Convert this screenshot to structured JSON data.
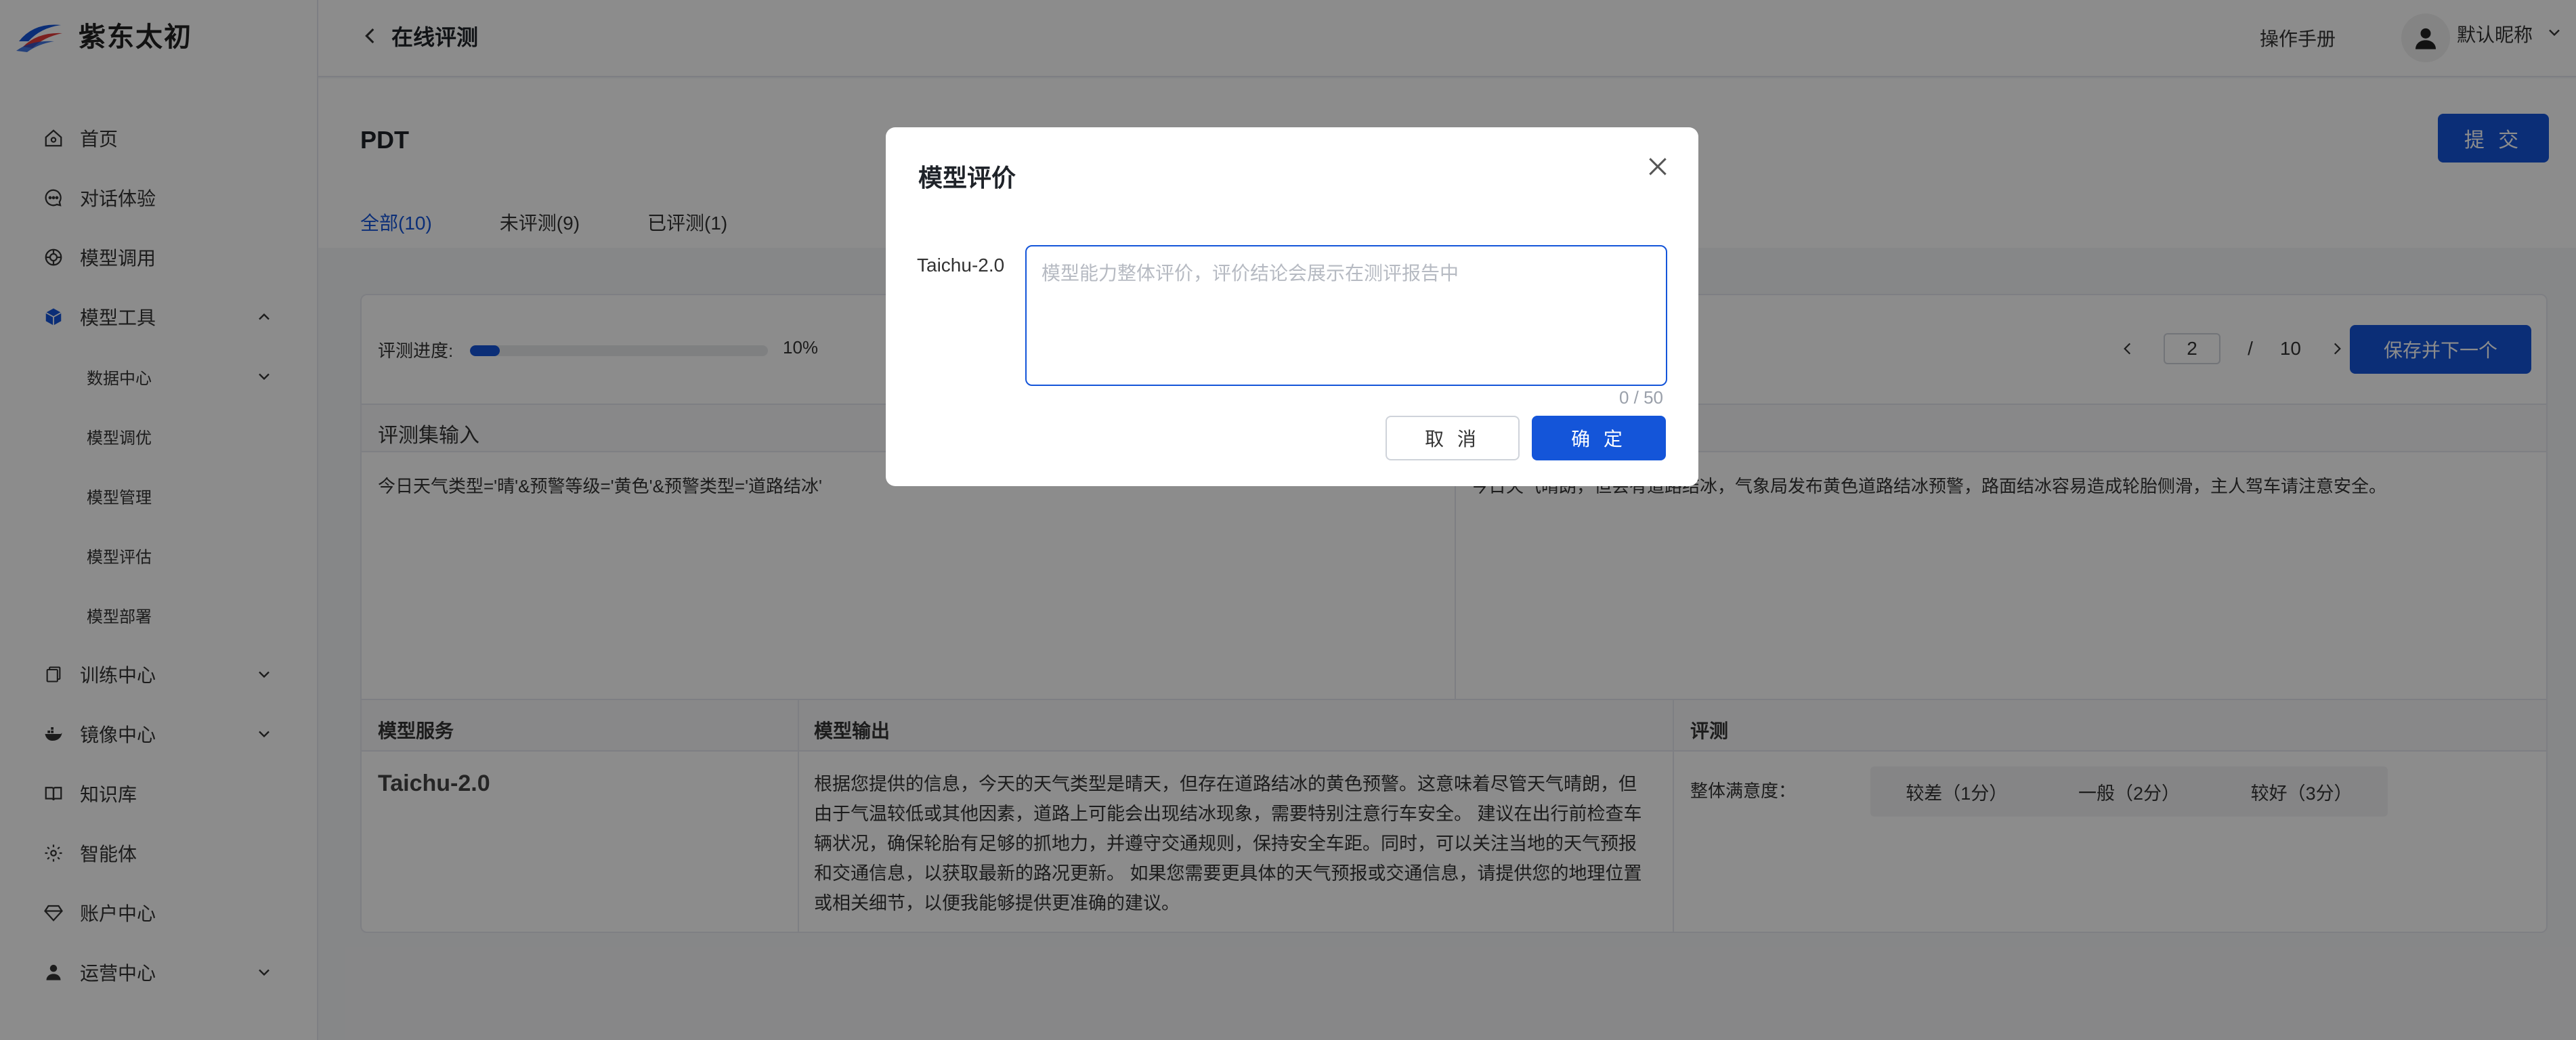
{
  "colors": {
    "accent": "#1455d9",
    "text": "#1f2329",
    "overlay": "rgba(0,0,0,0.45)"
  },
  "brand": {
    "name": "紫东太初"
  },
  "sidebar": {
    "items": [
      {
        "label": "首页",
        "icon": "home-icon"
      },
      {
        "label": "对话体验",
        "icon": "chat-icon"
      },
      {
        "label": "模型调用",
        "icon": "api-icon"
      },
      {
        "label": "模型工具",
        "icon": "cube-icon",
        "expanded": true
      },
      {
        "label": "数据中心",
        "sub": true,
        "chevron": "down"
      },
      {
        "label": "模型调优",
        "sub": true
      },
      {
        "label": "模型管理",
        "sub": true
      },
      {
        "label": "模型评估",
        "sub": true
      },
      {
        "label": "模型部署",
        "sub": true
      },
      {
        "label": "训练中心",
        "icon": "copy-icon",
        "chevron": "down"
      },
      {
        "label": "镜像中心",
        "icon": "docker-icon",
        "chevron": "down"
      },
      {
        "label": "知识库",
        "icon": "book-icon"
      },
      {
        "label": "智能体",
        "icon": "gear-icon"
      },
      {
        "label": "账户中心",
        "icon": "diamond-icon"
      },
      {
        "label": "运营中心",
        "icon": "user-icon",
        "chevron": "down"
      }
    ]
  },
  "header": {
    "back_label": "在线评测",
    "manual": "操作手册",
    "username": "默认昵称"
  },
  "page": {
    "title": "PDT",
    "submit": "提 交",
    "tabs": [
      {
        "label": "全部(10)",
        "active": true
      },
      {
        "label": "未评测(9)"
      },
      {
        "label": "已评测(1)"
      }
    ]
  },
  "progress": {
    "label": "评测进度:",
    "value": 0.1,
    "pct_text": "10%"
  },
  "pager": {
    "current": "2",
    "separator": "/",
    "total": "10",
    "save_next": "保存并下一个"
  },
  "eval_input": {
    "heading": "评测集输入",
    "left": "今日天气类型='晴'&预警等级='黄色'&预警类型='道路结冰'",
    "right": "今日天气晴朗，但会有道路结冰，气象局发布黄色道路结冰预警，路面结冰容易造成轮胎侧滑，主人驾车请注意安全。"
  },
  "table": {
    "headers": [
      "模型服务",
      "模型输出",
      "评测"
    ],
    "service": "Taichu-2.0",
    "output": "根据您提供的信息，今天的天气类型是晴天，但存在道路结冰的黄色预警。这意味着尽管天气晴朗，但由于气温较低或其他因素，道路上可能会出现结冰现象，需要特别注意行车安全。 建议在出行前检查车辆状况，确保轮胎有足够的抓地力，并遵守交通规则，保持安全车距。同时，可以关注当地的天气预报和交通信息，以获取最新的路况更新。 如果您需要更具体的天气预报或交通信息，请提供您的地理位置或相关细节，以便我能够提供更准确的建议。",
    "eval_label": "整体满意度：",
    "ratings": [
      "较差（1分）",
      "一般（2分）",
      "较好（3分）"
    ]
  },
  "modal": {
    "title": "模型评价",
    "label": "Taichu-2.0",
    "placeholder": "模型能力整体评价，评价结论会展示在测评报告中",
    "value": "",
    "count": "0 / 50",
    "cancel": "取 消",
    "ok": "确 定"
  }
}
